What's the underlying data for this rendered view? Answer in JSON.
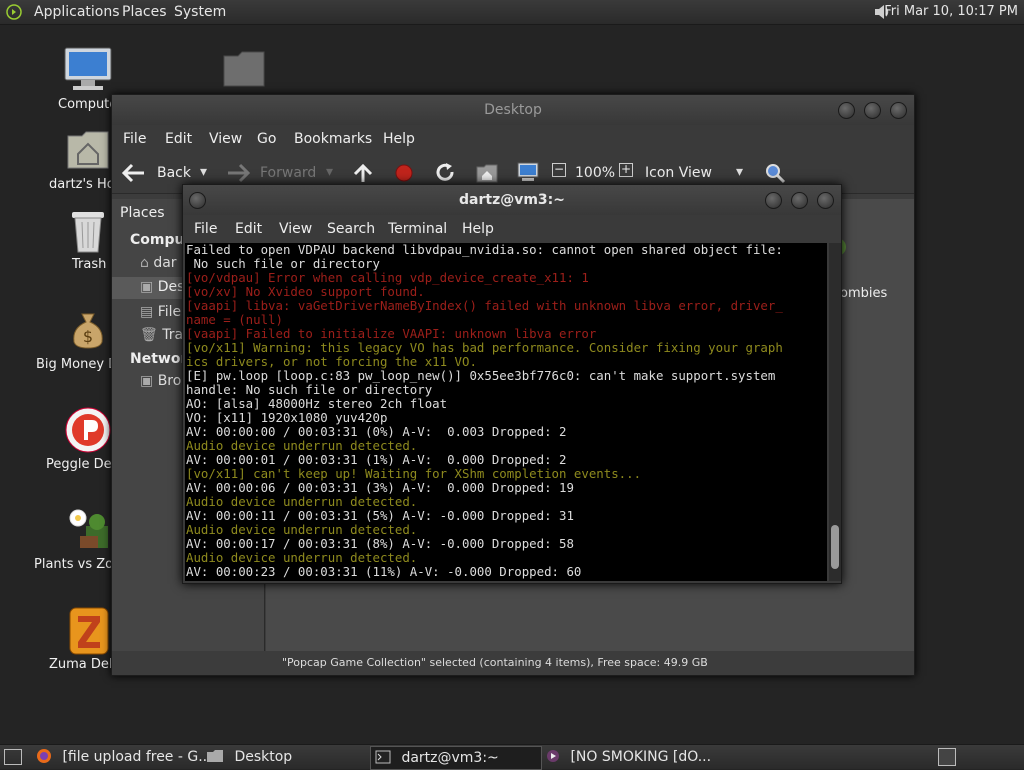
{
  "top_panel": {
    "menus": [
      "Applications",
      "Places",
      "System"
    ],
    "clock": "Fri Mar 10, 10:17 PM"
  },
  "desktop_icons": [
    {
      "label": "Compute",
      "icon": "computer-icon"
    },
    {
      "label": "dartz's Ho",
      "icon": "home-folder-icon"
    },
    {
      "label": "Trash",
      "icon": "trash-icon"
    },
    {
      "label": "Big Money D",
      "icon": "money-bag-icon"
    },
    {
      "label": "Peggle Del",
      "icon": "peggle-icon"
    },
    {
      "label": "Plants vs Zor",
      "icon": "plants-vs-zombies-icon"
    },
    {
      "label": "Zuma Delu",
      "icon": "zuma-icon"
    }
  ],
  "file_manager": {
    "title": "Desktop",
    "menu": [
      "File",
      "Edit",
      "View",
      "Go",
      "Bookmarks",
      "Help"
    ],
    "toolbar": {
      "back": "Back",
      "forward": "Forward",
      "zoom": "100%",
      "view_mode": "Icon View"
    },
    "sidebar": {
      "header": "Places",
      "section_computer": "Compute",
      "items": [
        "dar",
        "Des",
        "File",
        "Tra"
      ],
      "section_network": "Network",
      "network_items": [
        "Bro"
      ]
    },
    "content_partial_label": "ombies",
    "status": "\"Popcap Game Collection\" selected (containing 4 items), Free space: 49.9 GB"
  },
  "terminal": {
    "title": "dartz@vm3:~",
    "menu": [
      "File",
      "Edit",
      "View",
      "Search",
      "Terminal",
      "Help"
    ],
    "lines": [
      {
        "c": "white",
        "t": "Failed to open VDPAU backend libvdpau_nvidia.so: cannot open shared object file:"
      },
      {
        "c": "white",
        "t": " No such file or directory"
      },
      {
        "c": "red",
        "t": "[vo/vdpau] Error when calling vdp_device_create_x11: 1"
      },
      {
        "c": "red",
        "t": "[vo/xv] No Xvideo support found."
      },
      {
        "c": "red",
        "t": "[vaapi] libva: vaGetDriverNameByIndex() failed with unknown libva error, driver_"
      },
      {
        "c": "red",
        "t": "name = (null)"
      },
      {
        "c": "red",
        "t": "[vaapi] Failed to initialize VAAPI: unknown libva error"
      },
      {
        "c": "yellow",
        "t": "[vo/x11] Warning: this legacy VO has bad performance. Consider fixing your graph"
      },
      {
        "c": "yellow",
        "t": "ics drivers, or not forcing the x11 VO."
      },
      {
        "c": "white",
        "t": "[E] pw.loop [loop.c:83 pw_loop_new()] 0x55ee3bf776c0: can't make support.system"
      },
      {
        "c": "white",
        "t": "handle: No such file or directory"
      },
      {
        "c": "white",
        "t": "AO: [alsa] 48000Hz stereo 2ch float"
      },
      {
        "c": "white",
        "t": "VO: [x11] 1920x1080 yuv420p"
      },
      {
        "c": "white",
        "t": "AV: 00:00:00 / 00:03:31 (0%) A-V:  0.003 Dropped: 2"
      },
      {
        "c": "yellow",
        "t": "Audio device underrun detected."
      },
      {
        "c": "white",
        "t": "AV: 00:00:01 / 00:03:31 (1%) A-V:  0.000 Dropped: 2"
      },
      {
        "c": "yellow",
        "t": "[vo/x11] can't keep up! Waiting for XShm completion events..."
      },
      {
        "c": "white",
        "t": "AV: 00:00:06 / 00:03:31 (3%) A-V:  0.000 Dropped: 19"
      },
      {
        "c": "yellow",
        "t": "Audio device underrun detected."
      },
      {
        "c": "white",
        "t": "AV: 00:00:11 / 00:03:31 (5%) A-V: -0.000 Dropped: 31"
      },
      {
        "c": "yellow",
        "t": "Audio device underrun detected."
      },
      {
        "c": "white",
        "t": "AV: 00:00:17 / 00:03:31 (8%) A-V: -0.000 Dropped: 58"
      },
      {
        "c": "yellow",
        "t": "Audio device underrun detected."
      },
      {
        "c": "white",
        "t": "AV: 00:00:23 / 00:03:31 (11%) A-V: -0.000 Dropped: 60"
      }
    ]
  },
  "taskbar": {
    "tasks": [
      "[file upload free - G...",
      "Desktop",
      "dartz@vm3:~",
      "[NO SMOKING [dO..."
    ]
  },
  "colors": {
    "terminal_red": "#9d1f1a",
    "terminal_yellow": "#8e8a1e",
    "panel": "#2e2e2e"
  }
}
